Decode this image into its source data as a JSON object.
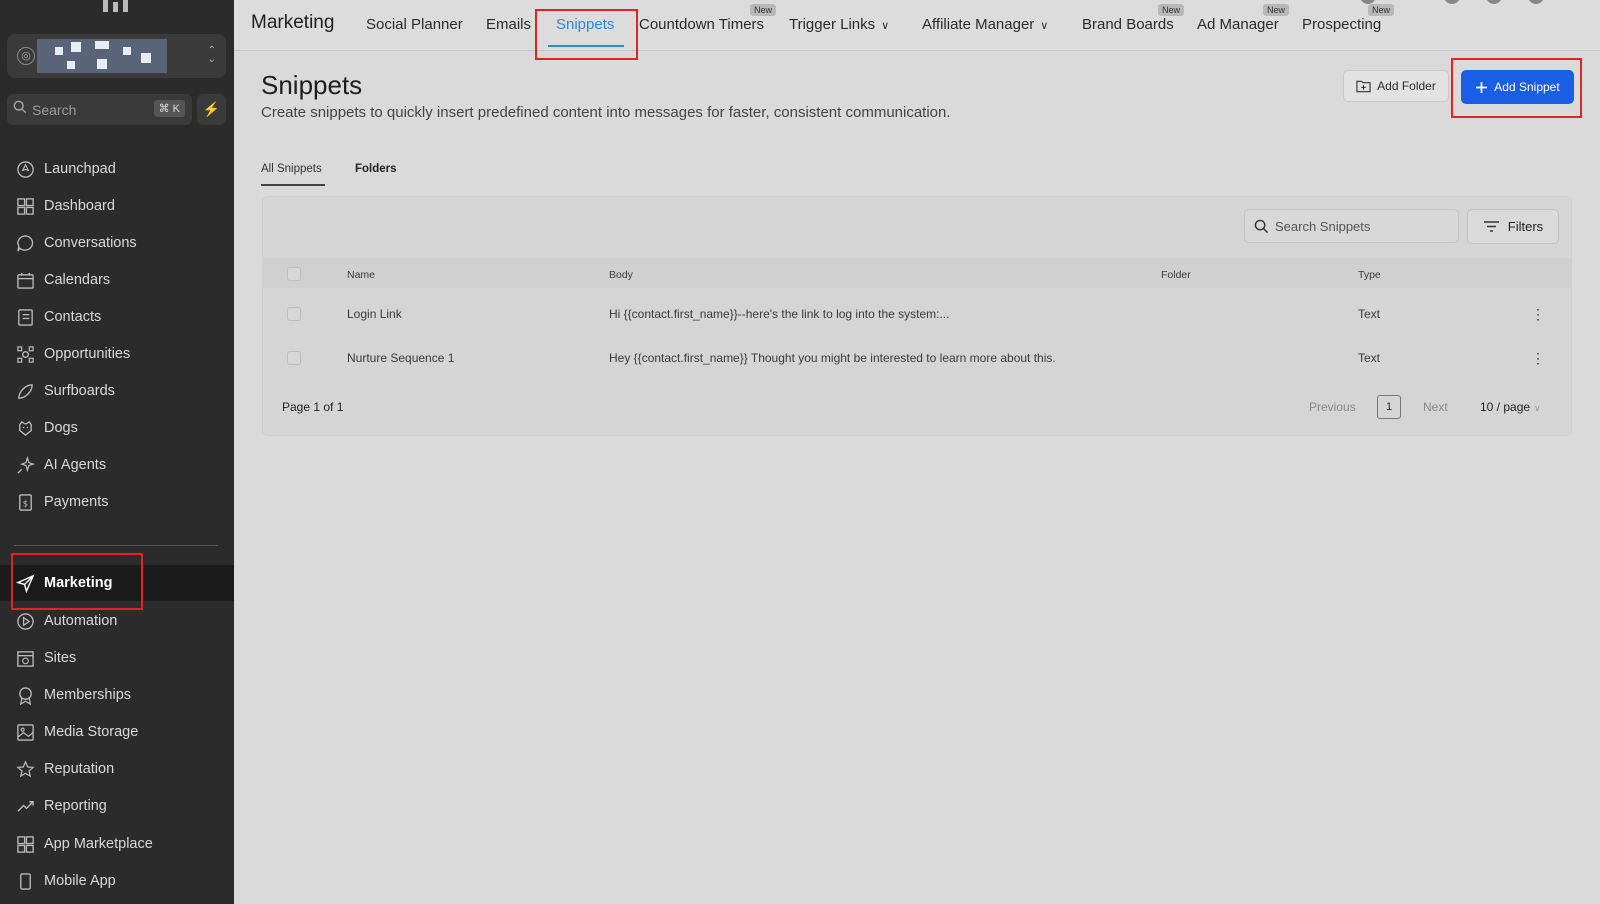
{
  "sidebar": {
    "search_label": "Search",
    "search_shortcut": "⌘ K",
    "items": [
      {
        "label": "Launchpad",
        "icon": "rocket-icon"
      },
      {
        "label": "Dashboard",
        "icon": "dashboard-icon"
      },
      {
        "label": "Conversations",
        "icon": "chat-icon"
      },
      {
        "label": "Calendars",
        "icon": "calendar-icon"
      },
      {
        "label": "Contacts",
        "icon": "contacts-icon"
      },
      {
        "label": "Opportunities",
        "icon": "opportunities-icon"
      },
      {
        "label": "Surfboards",
        "icon": "surfboard-icon"
      },
      {
        "label": "Dogs",
        "icon": "dog-icon"
      },
      {
        "label": "AI Agents",
        "icon": "sparkle-icon"
      },
      {
        "label": "Payments",
        "icon": "payments-icon"
      },
      {
        "label": "Marketing",
        "icon": "send-icon",
        "active": true
      },
      {
        "label": "Automation",
        "icon": "automation-icon"
      },
      {
        "label": "Sites",
        "icon": "sites-icon"
      },
      {
        "label": "Memberships",
        "icon": "memberships-icon"
      },
      {
        "label": "Media Storage",
        "icon": "image-icon"
      },
      {
        "label": "Reputation",
        "icon": "star-icon"
      },
      {
        "label": "Reporting",
        "icon": "chart-icon"
      },
      {
        "label": "App Marketplace",
        "icon": "grid-icon"
      },
      {
        "label": "Mobile App",
        "icon": "mobile-icon"
      }
    ]
  },
  "topbar": {
    "title": "Marketing",
    "tabs": [
      {
        "label": "Social Planner"
      },
      {
        "label": "Emails"
      },
      {
        "label": "Snippets",
        "active": true
      },
      {
        "label": "Countdown Timers",
        "badge": "New"
      },
      {
        "label": "Trigger Links",
        "dropdown": true
      },
      {
        "label": "Affiliate Manager",
        "dropdown": true
      },
      {
        "label": "Brand Boards",
        "badge": "New"
      },
      {
        "label": "Ad Manager",
        "badge": "New"
      },
      {
        "label": "Prospecting",
        "badge": "New"
      }
    ]
  },
  "main": {
    "title": "Snippets",
    "description": "Create snippets to quickly insert predefined content into messages for faster, consistent communication.",
    "add_folder_label": "Add Folder",
    "add_snippet_label": "Add Snippet",
    "subtabs": [
      {
        "label": "All Snippets",
        "active": true
      },
      {
        "label": "Folders"
      }
    ],
    "search_placeholder": "Search Snippets",
    "filters_label": "Filters",
    "table": {
      "columns": [
        "Name",
        "Body",
        "Folder",
        "Type"
      ],
      "rows": [
        {
          "name": "Login Link",
          "body": "Hi {{contact.first_name}}--here's the link to log into the system:...",
          "folder": "",
          "type": "Text"
        },
        {
          "name": "Nurture Sequence 1",
          "body": "Hey {{contact.first_name}} Thought you might be interested to learn more about this.",
          "folder": "",
          "type": "Text"
        }
      ]
    },
    "pagination": {
      "info": "Page 1 of 1",
      "previous": "Previous",
      "current": "1",
      "next": "Next",
      "per_page": "10 / page"
    }
  },
  "colors": {
    "accent": "#2d8ad8",
    "primary_button": "#1a5ee6",
    "highlight": "#e02424",
    "sidebar_bg": "#2b2b2b"
  }
}
